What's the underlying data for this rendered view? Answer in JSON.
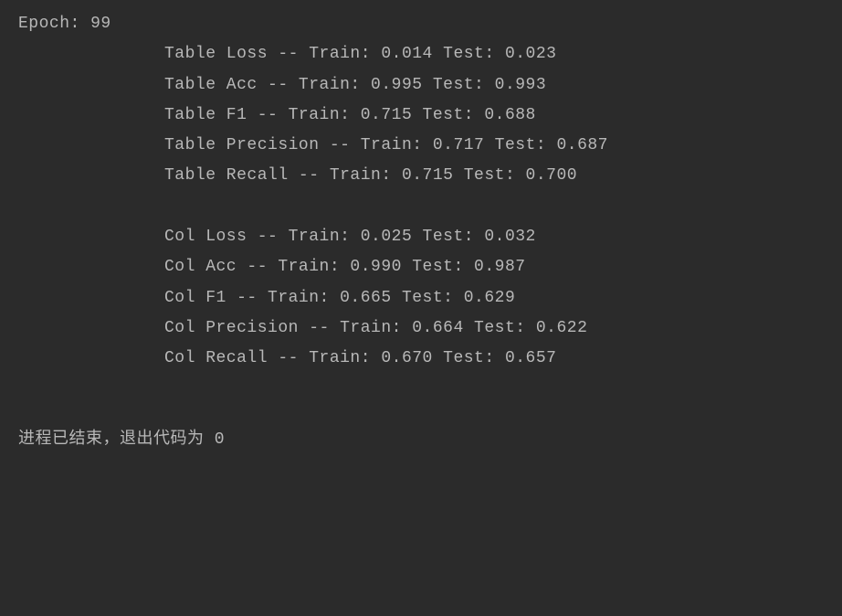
{
  "epoch_line": "Epoch: 99",
  "metrics": {
    "table_loss": "Table Loss -- Train: 0.014 Test: 0.023",
    "table_acc": "Table Acc -- Train: 0.995 Test: 0.993",
    "table_f1": "Table F1 -- Train: 0.715 Test: 0.688",
    "table_precision": "Table Precision -- Train: 0.717 Test: 0.687",
    "table_recall": "Table Recall -- Train: 0.715 Test: 0.700",
    "col_loss": "Col Loss -- Train: 0.025 Test: 0.032",
    "col_acc": "Col Acc -- Train: 0.990 Test: 0.987",
    "col_f1": "Col F1 -- Train: 0.665 Test: 0.629",
    "col_precision": "Col Precision -- Train: 0.664 Test: 0.622",
    "col_recall": "Col Recall -- Train: 0.670 Test: 0.657"
  },
  "footer_text": "进程已结束，退出代码为 0"
}
